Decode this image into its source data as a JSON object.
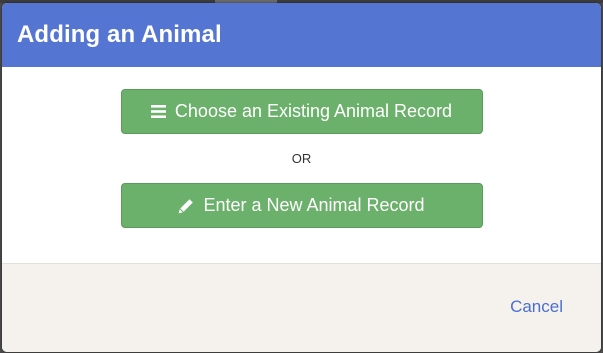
{
  "modal": {
    "title": "Adding an Animal",
    "choose_existing_label": "Choose an Existing Animal Record",
    "choose_existing_icon": "list-icon",
    "separator_text": "OR",
    "enter_new_label": "Enter a New Animal Record",
    "enter_new_icon": "pencil-icon",
    "cancel_label": "Cancel"
  },
  "colors": {
    "header": "#5575d3",
    "button": "#6bb06b",
    "footer": "#f5f2ee",
    "link": "#4b6fcf"
  }
}
